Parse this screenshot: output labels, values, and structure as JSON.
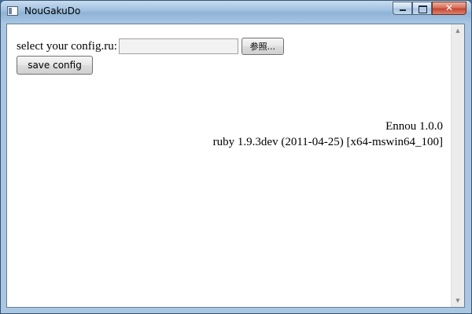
{
  "window": {
    "title": "NouGakuDo",
    "buttons": {
      "minimize_icon": "minimize-icon",
      "maximize_icon": "maximize-icon",
      "close_glyph": "✕"
    }
  },
  "form": {
    "config_label": "select your config.ru:",
    "config_value": "",
    "browse_label": "参照...",
    "save_label": "save config"
  },
  "info": {
    "app_version": "Ennou 1.0.0",
    "ruby_version": "ruby 1.9.3dev (2011-04-25) [x64-mswin64_100]"
  },
  "scrollbar": {
    "up_glyph": "▲",
    "down_glyph": "▼"
  }
}
